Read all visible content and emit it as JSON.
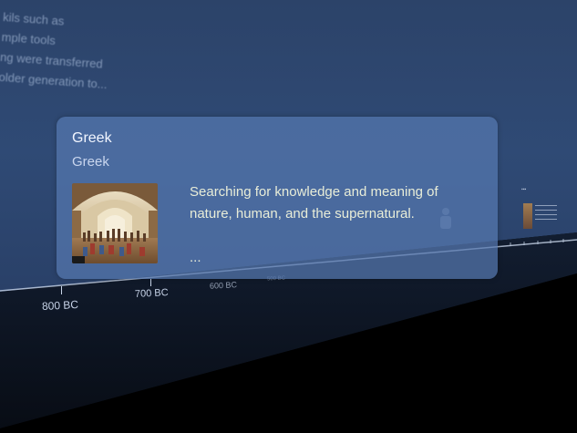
{
  "background_text": {
    "lines": "kils such as\nmple tools\nng were transferred\nolder generation to..."
  },
  "timeline": {
    "labels": {
      "t800": "800 BC",
      "t700": "700 BC",
      "t600": "600 BC",
      "t500": "500 BC"
    }
  },
  "event_card": {
    "title": "Greek",
    "subtitle": "Greek",
    "description": "Searching for knowledge and meaning of nature, human, and the supernatural.",
    "more": "..."
  },
  "colors": {
    "wall": "#2f4a75",
    "card": "#5678b0",
    "axis": "#c9d6ea"
  }
}
